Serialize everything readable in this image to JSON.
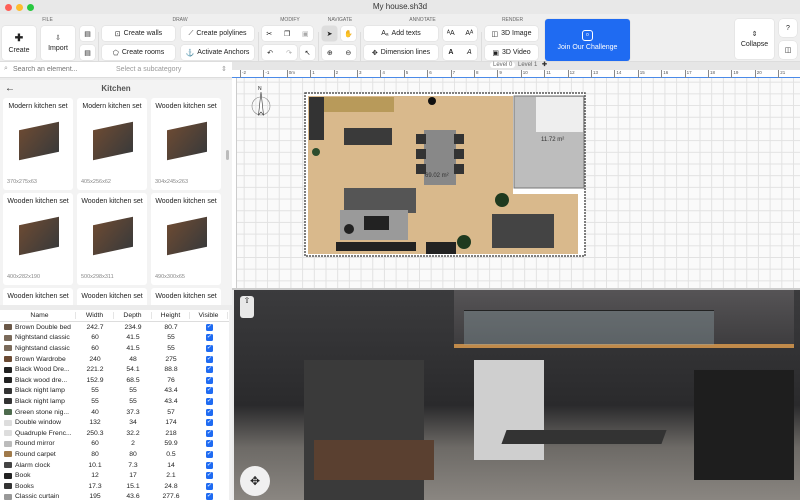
{
  "window": {
    "title": "My house.sh3d"
  },
  "toolbar": {
    "groups": {
      "file": "FILE",
      "draw": "DRAW",
      "modify": "MODIFY",
      "navigate": "NAVIGATE",
      "annotate": "ANNOTATE",
      "render": "RENDER"
    },
    "create": "Create",
    "import": "Import",
    "create_walls": "Create walls",
    "create_polylines": "Create polylines",
    "create_rooms": "Create rooms",
    "activate_anchors": "Activate Anchors",
    "add_texts": "Add texts",
    "dimension_lines": "Dimension lines",
    "image_3d": "3D Image",
    "video_3d": "3D Video",
    "challenge": "Join Our Challenge",
    "collapse": "Collapse"
  },
  "catalog": {
    "search_placeholder": "Search an element...",
    "subcategory_placeholder": "Select a subcategory",
    "category": "Kitchen",
    "items": [
      {
        "name": "Modern kitchen set",
        "dims": "370x275x63"
      },
      {
        "name": "Modern kitchen set",
        "dims": "405x256x62"
      },
      {
        "name": "Wooden kitchen set",
        "dims": "304x245x263"
      },
      {
        "name": "Wooden kitchen set",
        "dims": "400x282x190"
      },
      {
        "name": "Wooden kitchen set",
        "dims": "500x298x311"
      },
      {
        "name": "Wooden kitchen set",
        "dims": "490x300x65"
      },
      {
        "name": "Wooden kitchen set",
        "dims": ""
      },
      {
        "name": "Wooden kitchen set",
        "dims": ""
      },
      {
        "name": "Wooden kitchen set",
        "dims": ""
      }
    ]
  },
  "furniture": {
    "columns": [
      "Name",
      "Width",
      "Depth",
      "Height",
      "Visible"
    ],
    "rows": [
      [
        "Brown Double bed",
        "242.7",
        "234.9",
        "80.7"
      ],
      [
        "Nightstand classic",
        "60",
        "41.5",
        "55"
      ],
      [
        "Nightstand classic",
        "60",
        "41.5",
        "55"
      ],
      [
        "Brown Wardrobe",
        "240",
        "48",
        "275"
      ],
      [
        "Black Wood Dre...",
        "221.2",
        "54.1",
        "88.8"
      ],
      [
        "Black wood dre...",
        "152.9",
        "68.5",
        "76"
      ],
      [
        "Black night lamp",
        "55",
        "55",
        "43.4"
      ],
      [
        "Black night lamp",
        "55",
        "55",
        "43.4"
      ],
      [
        "Green stone nig...",
        "40",
        "37.3",
        "57"
      ],
      [
        "Double window",
        "132",
        "34",
        "174"
      ],
      [
        "Quadruple Frenc...",
        "250.3",
        "32.2",
        "218"
      ],
      [
        "Round mirror",
        "60",
        "2",
        "59.9"
      ],
      [
        "Round carpet",
        "80",
        "80",
        "0.5"
      ],
      [
        "Alarm clock",
        "10.1",
        "7.3",
        "14"
      ],
      [
        "Book",
        "12",
        "17",
        "2.1"
      ],
      [
        "Books",
        "17.3",
        "15.1",
        "24.8"
      ],
      [
        "Classic curtain",
        "195",
        "43.6",
        "277.6"
      ]
    ]
  },
  "plan": {
    "levels": [
      "Level 0",
      "Level 1"
    ],
    "ruler": [
      "-2",
      "-1",
      "0m",
      "1",
      "2",
      "3",
      "4",
      "5",
      "6",
      "7",
      "8",
      "9",
      "10",
      "11",
      "12",
      "13",
      "14",
      "15",
      "16",
      "17",
      "18",
      "19",
      "20",
      "21"
    ],
    "room_main_area": "69.02 m²",
    "room_bath_area": "11.72 m²",
    "compass": "N"
  },
  "colors": {
    "accent": "#1f6bf2",
    "floor": "#d9b98c",
    "bath": "#bdbdbd"
  }
}
